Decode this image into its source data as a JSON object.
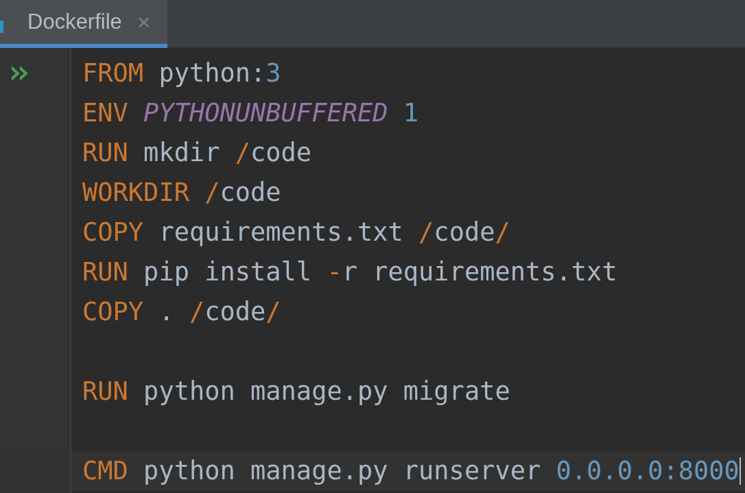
{
  "tabs": [
    {
      "label": "Dockerfile",
      "close": "×",
      "selected": true
    }
  ],
  "lines": [
    {
      "kind": "code",
      "runnable": true,
      "current": false,
      "tokens": [
        {
          "kind": "kw",
          "text": "FROM"
        },
        {
          "kind": "plain",
          "text": " python:"
        },
        {
          "kind": "num",
          "text": "3"
        }
      ]
    },
    {
      "kind": "code",
      "runnable": false,
      "current": false,
      "tokens": [
        {
          "kind": "kw",
          "text": "ENV "
        },
        {
          "kind": "var",
          "text": "PYTHONUNBUFFERED "
        },
        {
          "kind": "num",
          "text": "1"
        }
      ]
    },
    {
      "kind": "code",
      "runnable": false,
      "current": false,
      "tokens": [
        {
          "kind": "kw",
          "text": "RUN"
        },
        {
          "kind": "plain",
          "text": " mkdir "
        },
        {
          "kind": "op",
          "text": "/"
        },
        {
          "kind": "plain",
          "text": "code"
        }
      ]
    },
    {
      "kind": "code",
      "runnable": false,
      "current": false,
      "tokens": [
        {
          "kind": "kw",
          "text": "WORKDIR "
        },
        {
          "kind": "op",
          "text": "/"
        },
        {
          "kind": "plain",
          "text": "code"
        }
      ]
    },
    {
      "kind": "code",
      "runnable": false,
      "current": false,
      "tokens": [
        {
          "kind": "kw",
          "text": "COPY"
        },
        {
          "kind": "plain",
          "text": " requirements.txt "
        },
        {
          "kind": "op",
          "text": "/"
        },
        {
          "kind": "plain",
          "text": "code"
        },
        {
          "kind": "op",
          "text": "/"
        }
      ]
    },
    {
      "kind": "code",
      "runnable": false,
      "current": false,
      "tokens": [
        {
          "kind": "kw",
          "text": "RUN"
        },
        {
          "kind": "plain",
          "text": " pip install "
        },
        {
          "kind": "op",
          "text": "-"
        },
        {
          "kind": "plain",
          "text": "r requirements.txt"
        }
      ]
    },
    {
      "kind": "code",
      "runnable": false,
      "current": false,
      "tokens": [
        {
          "kind": "kw",
          "text": "COPY"
        },
        {
          "kind": "plain",
          "text": " . "
        },
        {
          "kind": "op",
          "text": "/"
        },
        {
          "kind": "plain",
          "text": "code"
        },
        {
          "kind": "op",
          "text": "/"
        }
      ]
    },
    {
      "kind": "blank",
      "runnable": false,
      "current": false
    },
    {
      "kind": "code",
      "runnable": false,
      "current": false,
      "tokens": [
        {
          "kind": "kw",
          "text": "RUN"
        },
        {
          "kind": "plain",
          "text": " python manage.py migrate"
        }
      ]
    },
    {
      "kind": "blank",
      "runnable": false,
      "current": false
    },
    {
      "kind": "code",
      "runnable": false,
      "current": true,
      "tokens": [
        {
          "kind": "kw",
          "text": "CMD"
        },
        {
          "kind": "plain",
          "text": " python manage.py runserver "
        },
        {
          "kind": "num",
          "text": "0.0.0.0:8000"
        }
      ]
    }
  ]
}
